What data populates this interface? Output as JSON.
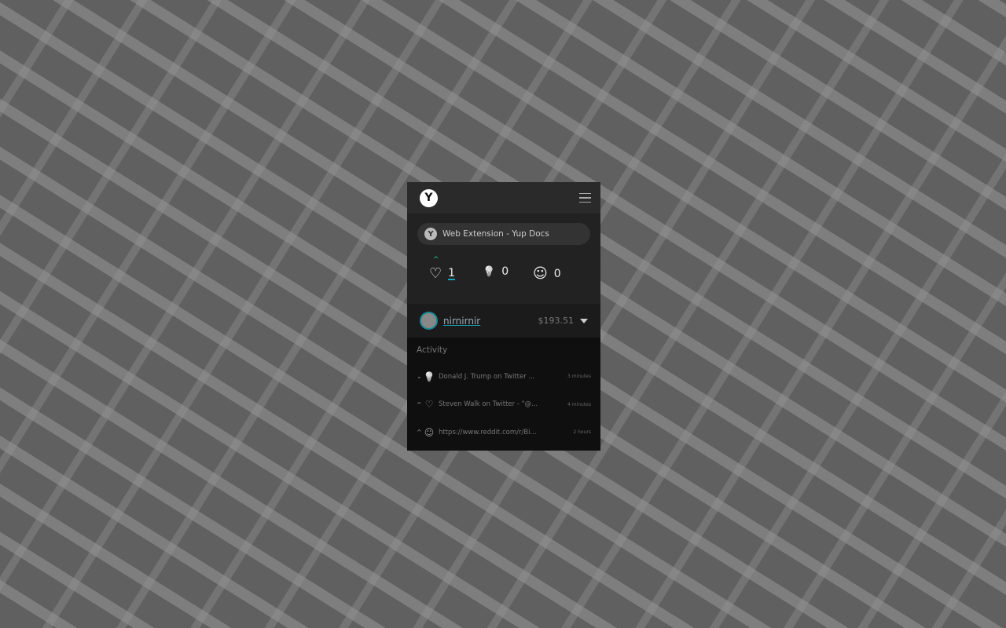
{
  "header": {
    "logo": "Y",
    "menu_icon": "hamburger-icon"
  },
  "page": {
    "title": "Web Extension - Yup Docs",
    "icon": "Y"
  },
  "rates": [
    {
      "icon": "heart-icon",
      "glyph": "♡",
      "count": "1",
      "upvoted": true
    },
    {
      "icon": "lightbulb-icon",
      "glyph": "💡",
      "count": "0"
    },
    {
      "icon": "smile-icon",
      "glyph": "☺",
      "count": "0"
    }
  ],
  "user": {
    "name": "nirnirnir",
    "balance": "$193.51"
  },
  "activity": {
    "title": "Activity",
    "items": [
      {
        "arrow": "⌄",
        "glyph": "💡",
        "text": "Donald J. Trump on Twitter ...",
        "time": "3 minutes"
      },
      {
        "arrow": "^",
        "glyph": "♡",
        "text": "Steven Walk on Twitter - \"@...",
        "time": "4 minutes"
      },
      {
        "arrow": "^",
        "glyph": "☺",
        "text": "https://www.reddit.com/r/Bi...",
        "time": "2 hours"
      }
    ]
  },
  "colors": {
    "accent": "#17a2b8",
    "upvote": "#1fd08a"
  }
}
